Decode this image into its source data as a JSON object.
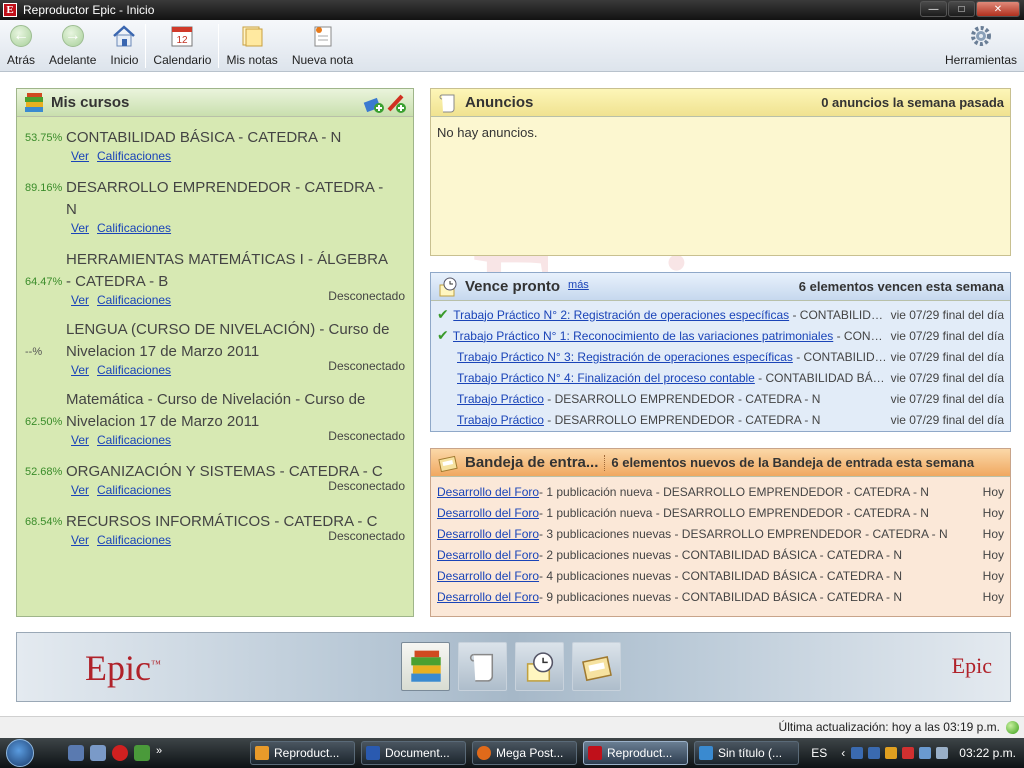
{
  "window": {
    "title": "Reproductor Epic - Inicio",
    "app_icon_letter": "E"
  },
  "toolbar": {
    "back": "Atrás",
    "forward": "Adelante",
    "home": "Inicio",
    "calendar": "Calendario",
    "calendar_day": "12",
    "notes": "Mis notas",
    "new_note": "Nueva nota",
    "tools": "Herramientas"
  },
  "courses": {
    "title": "Mis cursos",
    "items": [
      {
        "pct": "53.75%",
        "name": "CONTABILIDAD BÁSICA - CATEDRA - N",
        "view": "Ver",
        "grades": "Calificaciones",
        "status": ""
      },
      {
        "pct": "89.16%",
        "name": "DESARROLLO EMPRENDEDOR - CATEDRA - N",
        "view": "Ver",
        "grades": "Calificaciones",
        "status": ""
      },
      {
        "pct": "64.47%",
        "name": "HERRAMIENTAS MATEMÁTICAS I - ÁLGEBRA - CATEDRA - B",
        "view": "Ver",
        "grades": "Calificaciones",
        "status": "Desconectado"
      },
      {
        "pct": "--%",
        "name": "LENGUA (CURSO DE NIVELACIÓN) - Curso de Nivelacion 17 de Marzo 2011",
        "view": "Ver",
        "grades": "Calificaciones",
        "status": "Desconectado"
      },
      {
        "pct": "62.50%",
        "name": "Matemática - Curso de Nivelación - Curso de Nivelacion 17 de Marzo 2011",
        "view": "Ver",
        "grades": "Calificaciones",
        "status": "Desconectado"
      },
      {
        "pct": "52.68%",
        "name": "ORGANIZACIÓN Y SISTEMAS - CATEDRA - C",
        "view": "Ver",
        "grades": "Calificaciones",
        "status": "Desconectado"
      },
      {
        "pct": "68.54%",
        "name": "RECURSOS INFORMÁTICOS - CATEDRA - C",
        "view": "Ver",
        "grades": "Calificaciones",
        "status": "Desconectado"
      }
    ]
  },
  "announcements": {
    "title": "Anuncios",
    "summary": "0 anuncios la semana pasada",
    "empty": "No hay anuncios."
  },
  "due": {
    "title": "Vence pronto",
    "more": "más",
    "summary": "6 elementos vencen esta semana",
    "items": [
      {
        "done": true,
        "link": " Trabajo Práctico N° 2: Registración de operaciones específicas",
        "rest": " - CONTABILIDAD BÁSICA - CATEDRA - N",
        "when": "vie 07/29 final del día"
      },
      {
        "done": true,
        "link": "Trabajo Práctico N° 1: Reconocimiento de las variaciones patrimoniales",
        "rest": " - CONTABILIDAD BÁSICA - CATEDRA - N",
        "when": "vie 07/29 final del día"
      },
      {
        "done": false,
        "link": "Trabajo Práctico N° 3: Registración de operaciones específicas",
        "rest": " - CONTABILIDAD BÁSICA - CATEDRA - N",
        "when": "vie 07/29 final del día"
      },
      {
        "done": false,
        "link": "Trabajo Práctico N° 4: Finalización del proceso contable",
        "rest": " - CONTABILIDAD BÁSICA - CATEDRA - N",
        "when": "vie 07/29 final del día"
      },
      {
        "done": false,
        "link": "Trabajo Práctico",
        "rest": " - DESARROLLO EMPRENDEDOR - CATEDRA - N",
        "when": "vie 07/29 final del día"
      },
      {
        "done": false,
        "link": "Trabajo Práctico",
        "rest": " - DESARROLLO EMPRENDEDOR - CATEDRA - N",
        "when": "vie 07/29 final del día"
      }
    ]
  },
  "inbox": {
    "title": "Bandeja de entra...",
    "summary": "6 elementos nuevos de la Bandeja de entrada esta semana",
    "items": [
      {
        "link": "Desarrollo del Foro",
        "rest": " - 1 publicación nueva - DESARROLLO EMPRENDEDOR - CATEDRA - N",
        "when": "Hoy"
      },
      {
        "link": "Desarrollo del Foro",
        "rest": " - 1 publicación nueva - DESARROLLO EMPRENDEDOR - CATEDRA - N",
        "when": "Hoy"
      },
      {
        "link": "Desarrollo del Foro",
        "rest": " - 3 publicaciones nuevas - DESARROLLO EMPRENDEDOR - CATEDRA - N",
        "when": "Hoy"
      },
      {
        "link": "Desarrollo del Foro",
        "rest": " - 2 publicaciones nuevas - CONTABILIDAD BÁSICA - CATEDRA - N",
        "when": "Hoy"
      },
      {
        "link": "Desarrollo del Foro",
        "rest": " - 4 publicaciones nuevas - CONTABILIDAD BÁSICA - CATEDRA - N",
        "when": "Hoy"
      },
      {
        "link": "Desarrollo del Foro",
        "rest": " - 9 publicaciones nuevas - CONTABILIDAD BÁSICA - CATEDRA - N",
        "when": "Hoy"
      }
    ]
  },
  "watermark": "Epic",
  "footer": {
    "logo_left": "Epic",
    "logo_right": "Epic",
    "logo_tm": "™"
  },
  "status": {
    "text": "Última actualización: hoy a las 03:19 p.m."
  },
  "taskbar": {
    "tasks": [
      "Reproduct...",
      "Document...",
      "Mega Post...",
      "Reproduct...",
      "Sin título (..."
    ],
    "active_index": 3,
    "lang": "ES",
    "time": "03:22 p.m."
  },
  "colors": {
    "courses_bg": "#d7e9b3",
    "announcements_bg": "#fcf7d0",
    "due_bg": "#e2ecf8",
    "inbox_bg": "#fbe8d8",
    "link": "#1a44b8",
    "percent": "#3a8c2a",
    "brand": "#b0222a"
  },
  "icons": {
    "back": "arrow-left-icon",
    "forward": "arrow-right-icon",
    "home": "house-icon",
    "calendar": "calendar-icon",
    "notes": "folder-icon",
    "new_note": "note-icon",
    "tools": "gear-icon",
    "courses": "books-icon",
    "announcements": "scroll-icon",
    "due": "clock-icon",
    "inbox": "inbox-icon"
  }
}
